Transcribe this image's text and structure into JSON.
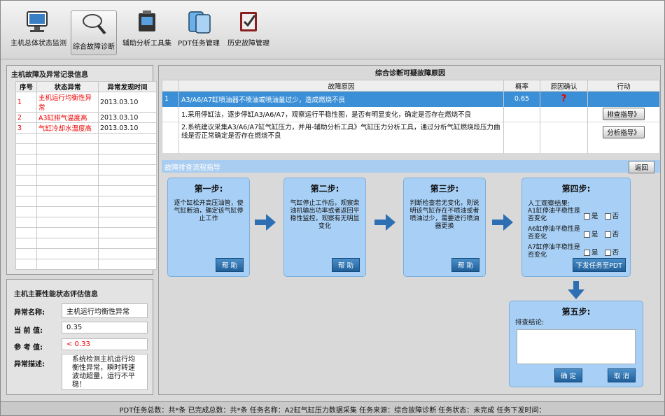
{
  "toolbar": {
    "items": [
      {
        "label": "主机总体状态监测"
      },
      {
        "label": "综合故障诊断"
      },
      {
        "label": "辅助分析工具集"
      },
      {
        "label": "PDT任务管理"
      },
      {
        "label": "历史故障管理"
      }
    ]
  },
  "faults": {
    "title": "主机故障及异常记录信息",
    "headers": [
      "序号",
      "状态异常",
      "异常发现时间"
    ],
    "rows": [
      [
        "1",
        "主机运行均衡性异常",
        "2013.03.10"
      ],
      [
        "2",
        "A3缸排气温度高",
        "2013.03.10"
      ],
      [
        "3",
        "气缸冷却水温度高",
        "2013.03.10"
      ]
    ]
  },
  "perf": {
    "title": "主机主要性能状态评估信息",
    "name_label": "异常名称:",
    "name_value": "主机运行均衡性异常",
    "cur_label": "当 前 值:",
    "cur_value": "0.35",
    "ref_label": "参 考 值:",
    "ref_value": "< 0.33",
    "desc_label": "异常描述:",
    "desc_value": "系统检测主机运行均衡性异常，瞬时转速波动超量，运行不平稳！"
  },
  "diag": {
    "title": "综合诊断可疑故障原因",
    "headers": [
      "故障原因",
      "概率",
      "原因确认",
      "行动"
    ],
    "row_no": "1",
    "cause": "A3/A6/A7缸喷油器不喷油或喷油量过少，造成燃烧不良",
    "prob": "0.65",
    "confirm": "?",
    "sub1": "1.采用停缸法，逐步停缸A3/A6/A7，观察运行平稳性图，是否有明显变化，确定是否存在燃烧不良",
    "sub1_btn": "排查指导》",
    "sub2": "2.系统建议采集A3/A6/A7缸气缸压力，并用-辅助分析工具》气缸压力分析工具，通过分析气缸燃烧段压力曲线是否正常确定是否存在燃烧不良",
    "sub2_btn": "分析指导》"
  },
  "flow": {
    "title": "故障排查流程指导",
    "back": "返回",
    "step1_title": "第一步:",
    "step1_text": "逐个缸松开高压油管，使气缸断油，确定该气缸停止工作",
    "step1_btn": "帮 助",
    "step2_title": "第二步:",
    "step2_text": "气缸停止工作后，观察柴油机输出功率或者返回平稳性监控，观察有无明显变化",
    "step2_btn": "帮 助",
    "step3_title": "第三步:",
    "step3_text": "判断检查若无变化，则说明该气缸存在不喷油或者喷油过少，需要进行喷油器更换",
    "step3_btn": "帮 助",
    "step4_title": "第四步:",
    "step4_head": "人工观察结果:",
    "checks": [
      {
        "label": "A1缸停油平稳性是否变化"
      },
      {
        "label": "A6缸停油平稳性是否变化"
      },
      {
        "label": "A7缸停油平稳性是否变化"
      }
    ],
    "yes": "是",
    "no": "否",
    "step4_btn": "下发任务至PDT",
    "step5_title": "第五步:",
    "step5_label": "排查结论:",
    "ok": "确 定",
    "cancel": "取 消"
  },
  "status": {
    "text": "PDT任务总数：共*条  已完成总数：共*条  任务名称：A2缸气缸压力数据采集  任务来源：综合故障诊断  任务状态：未完成  任务下发时间："
  }
}
